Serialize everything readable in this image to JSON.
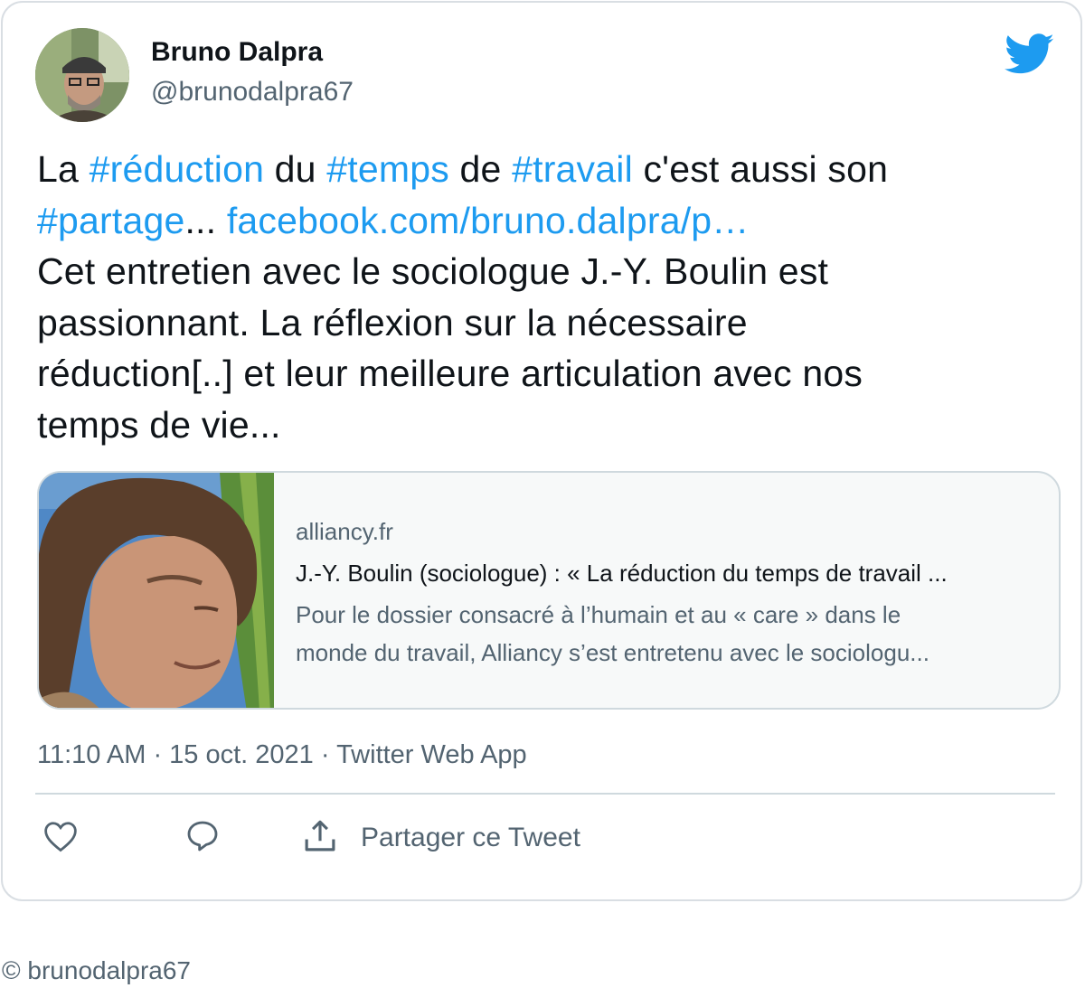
{
  "author": {
    "display_name": "Bruno Dalpra",
    "handle": "@brunodalpra67"
  },
  "tweet": {
    "lines": [
      [
        {
          "text": "La ",
          "link": false
        },
        {
          "text": "#réduction",
          "link": true
        },
        {
          "text": " du ",
          "link": false
        },
        {
          "text": "#temps",
          "link": true
        },
        {
          "text": " de ",
          "link": false
        },
        {
          "text": "#travail",
          "link": true
        },
        {
          "text": " c'est aussi son",
          "link": false
        }
      ],
      [
        {
          "text": "#partage",
          "link": true
        },
        {
          "text": "... ",
          "link": false
        },
        {
          "text": "facebook.com/bruno.dalpra/p…",
          "link": true
        }
      ],
      [
        {
          "text": "Cet entretien avec le sociologue J.-Y. Boulin est",
          "link": false
        }
      ],
      [
        {
          "text": "passionnant. La réflexion sur la nécessaire",
          "link": false
        }
      ],
      [
        {
          "text": "réduction[..] et leur meilleure articulation avec nos",
          "link": false
        }
      ],
      [
        {
          "text": "temps de vie...",
          "link": false
        }
      ]
    ]
  },
  "preview": {
    "domain": "alliancy.fr",
    "title": "J.-Y. Boulin (sociologue) : « La réduction du temps de travail ...",
    "desc_line1": "Pour le dossier consacré à l’humain et au « care » dans le",
    "desc_line2": "monde du travail, Alliancy s’est entretenu avec le sociologu..."
  },
  "meta": {
    "time": "11:10 AM",
    "sep1": " · ",
    "date": "15 oct. 2021",
    "sep2": " · ",
    "source": "Twitter Web App"
  },
  "actions": {
    "share_label": "Partager ce Tweet"
  },
  "footer": {
    "copyright": "© brunodalpra67"
  },
  "colors": {
    "link": "#1d9bf0",
    "text": "#0f1419",
    "secondary": "#536471",
    "border": "#cfd9de"
  },
  "icons": [
    "twitter-bird-icon",
    "heart-icon",
    "reply-icon",
    "share-icon"
  ]
}
